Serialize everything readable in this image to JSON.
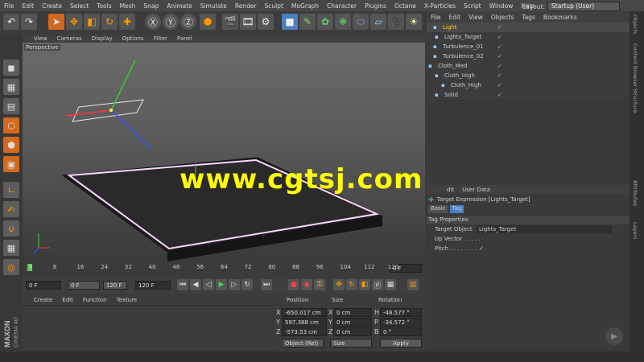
{
  "menubar": [
    "File",
    "Edit",
    "Create",
    "Select",
    "Tools",
    "Mesh",
    "Snap",
    "Animate",
    "Simulate",
    "Render",
    "Sculpt",
    "MoGraph",
    "Character",
    "Plugins",
    "Octane",
    "X-Particles",
    "Script",
    "Window",
    "Help"
  ],
  "layout": {
    "label": "Layout:",
    "value": "Startup (User)"
  },
  "viewport": {
    "menu": [
      "View",
      "Cameras",
      "Display",
      "Options",
      "Filter",
      "Panel"
    ],
    "label": "Perspective"
  },
  "watermark": "www.cgtsj.com",
  "timeline": {
    "ticks": [
      "0",
      "8",
      "16",
      "24",
      "32",
      "40",
      "48",
      "56",
      "64",
      "72",
      "80",
      "88",
      "96",
      "104",
      "112",
      "120"
    ],
    "end": "0 F"
  },
  "transport": {
    "start": "0 F",
    "min": "0 F",
    "max": "120 F",
    "end": "120 F"
  },
  "material_manager": {
    "menu": [
      "Create",
      "Edit",
      "Function",
      "Texture"
    ]
  },
  "coordinates": {
    "headers": [
      "Position",
      "Size",
      "Rotation"
    ],
    "rows": [
      {
        "a": "X",
        "pos": "-650.017 cm",
        "b": "X",
        "size": "0 cm",
        "c": "H",
        "rot": "-48.577 °"
      },
      {
        "a": "Y",
        "pos": "597.388 cm",
        "b": "Y",
        "size": "0 cm",
        "c": "P",
        "rot": "-34.572 °"
      },
      {
        "a": "Z",
        "pos": "-573.53 cm",
        "b": "Z",
        "size": "0 cm",
        "c": "B",
        "rot": "0 °"
      }
    ],
    "mode": "Object (Rel)",
    "size_mode": "Size",
    "apply": "Apply"
  },
  "object_manager": {
    "menu": [
      "File",
      "Edit",
      "View",
      "Objects",
      "Tags",
      "Bookmarks"
    ],
    "objects": [
      {
        "name": "Light",
        "highlight": true
      },
      {
        "name": "Lights_Target",
        "highlight": false
      },
      {
        "name": "Turbulence_01",
        "highlight": false
      },
      {
        "name": "Turbulence_02",
        "highlight": false
      },
      {
        "name": "Cloth_Med",
        "highlight": false
      },
      {
        "name": "Cloth_High",
        "highlight": false
      },
      {
        "name": "Cloth_High",
        "highlight": false
      },
      {
        "name": "Solid",
        "highlight": false
      }
    ]
  },
  "attributes": {
    "menu": [
      "dit",
      "User Data"
    ],
    "title": "Target Expression [Lights_Target]",
    "tabs": [
      "Basic",
      "Tag"
    ],
    "section": "Tag Properties",
    "props": [
      {
        "label": "Target Object",
        "value": "Lights_Target"
      },
      {
        "label": "Up Vector . . . . .",
        "value": ""
      },
      {
        "label": "Pitch . . . . . . . .",
        "value": "✓"
      }
    ]
  },
  "side_tabs": [
    "Objects",
    "Content Browser",
    "Structure",
    "Attributes",
    "Layers"
  ],
  "maxon": {
    "brand": "MAXON",
    "product": "CINEMA 4D"
  }
}
